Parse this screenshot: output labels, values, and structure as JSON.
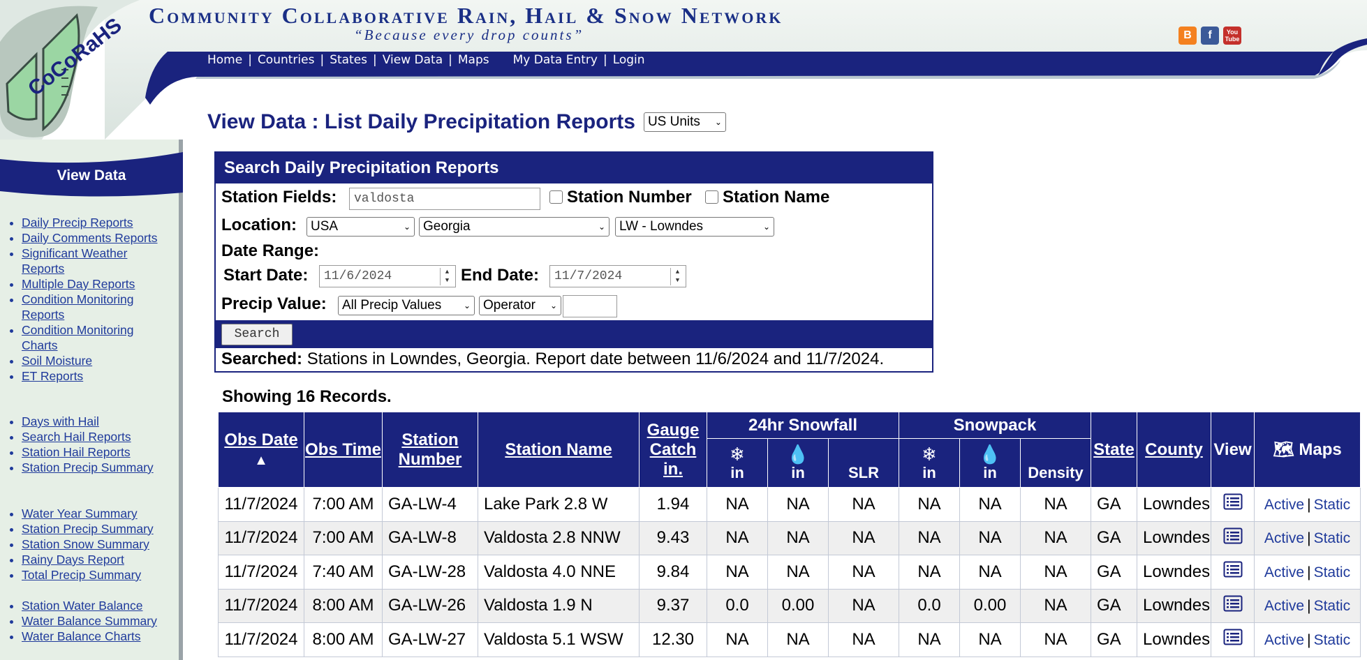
{
  "header": {
    "site_title": "Community Collaborative Rain, Hail & Snow Network",
    "logo_text": "CoCoRaHS",
    "tagline": "“Because every drop counts”",
    "nav": [
      "Home",
      "Countries",
      "States",
      "View Data",
      "Maps"
    ],
    "nav_right": [
      "My Data Entry",
      "Login"
    ],
    "social": {
      "blogger": "B",
      "facebook": "f",
      "youtube": "You Tube"
    },
    "colors": {
      "brand_blue": "#1a237e",
      "logo_green": "#9bd6a3"
    }
  },
  "sidebar": {
    "title": "View Data",
    "group1": [
      "Daily Precip Reports",
      "Daily Comments Reports",
      "Significant Weather Reports",
      "Multiple Day Reports",
      "Condition Monitoring Reports",
      "Condition Monitoring Charts",
      "Soil Moisture",
      "ET Reports"
    ],
    "group2": [
      "Days with Hail",
      "Search Hail Reports",
      "Station Hail Reports",
      "Station Precip Summary"
    ],
    "group3": [
      "Water Year Summary",
      "Station Precip Summary",
      "Station Snow Summary",
      "Rainy Days Report",
      "Total Precip Summary"
    ],
    "group4": [
      "Station Water Balance",
      "Water Balance Summary",
      "Water Balance Charts"
    ]
  },
  "main": {
    "page_title": "View Data : List Daily Precipitation Reports",
    "units_select": "US Units",
    "search": {
      "heading": "Search Daily Precipitation Reports",
      "station_fields_label": "Station Fields:",
      "station_fields_value": "valdosta",
      "station_number_label": "Station Number",
      "station_name_label": "Station Name",
      "location_label": "Location:",
      "country": "USA",
      "state": "Georgia",
      "county": "LW - Lowndes",
      "date_range_label": "Date Range:",
      "start_date_label": "Start Date:",
      "start_date": "11/6/2024",
      "end_date_label": "End Date:",
      "end_date": "11/7/2024",
      "precip_value_label": "Precip Value:",
      "precip_select": "All Precip Values",
      "operator_select": "Operator",
      "precip_input": "",
      "button_label": "Search",
      "searched_label": "Searched:",
      "searched_text": "Stations in Lowndes, Georgia. Report date between 11/6/2024 and 11/7/2024."
    },
    "record_count": "Showing 16 Records.",
    "table": {
      "headers": {
        "obs_date": "Obs Date",
        "sort_arrow": "▲",
        "obs_time": "Obs Time",
        "station_number": "Station Number",
        "station_name": "Station Name",
        "gauge_catch": "Gauge Catch in.",
        "snowfall": "24hr Snowfall",
        "snowpack": "Snowpack",
        "unit_in": "in",
        "slr": "SLR",
        "density": "Density",
        "state": "State",
        "county": "County",
        "view": "View",
        "maps": "Maps"
      },
      "links": {
        "active": "Active",
        "static": "Static",
        "pipe": "|"
      },
      "rows": [
        {
          "date": "11/7/2024",
          "time": "7:00 AM",
          "number": "GA-LW-4",
          "name": "Lake Park 2.8 W",
          "catch": "1.94",
          "sf_in": "NA",
          "sf_we": "NA",
          "slr": "NA",
          "sp_in": "NA",
          "sp_we": "NA",
          "density": "NA",
          "state": "GA",
          "county": "Lowndes"
        },
        {
          "date": "11/7/2024",
          "time": "7:00 AM",
          "number": "GA-LW-8",
          "name": "Valdosta 2.8 NNW",
          "catch": "9.43",
          "sf_in": "NA",
          "sf_we": "NA",
          "slr": "NA",
          "sp_in": "NA",
          "sp_we": "NA",
          "density": "NA",
          "state": "GA",
          "county": "Lowndes"
        },
        {
          "date": "11/7/2024",
          "time": "7:40 AM",
          "number": "GA-LW-28",
          "name": "Valdosta 4.0 NNE",
          "catch": "9.84",
          "sf_in": "NA",
          "sf_we": "NA",
          "slr": "NA",
          "sp_in": "NA",
          "sp_we": "NA",
          "density": "NA",
          "state": "GA",
          "county": "Lowndes"
        },
        {
          "date": "11/7/2024",
          "time": "8:00 AM",
          "number": "GA-LW-26",
          "name": "Valdosta 1.9 N",
          "catch": "9.37",
          "sf_in": "0.0",
          "sf_we": "0.00",
          "slr": "NA",
          "sp_in": "0.0",
          "sp_we": "0.00",
          "density": "NA",
          "state": "GA",
          "county": "Lowndes"
        },
        {
          "date": "11/7/2024",
          "time": "8:00 AM",
          "number": "GA-LW-27",
          "name": "Valdosta 5.1 WSW",
          "catch": "12.30",
          "sf_in": "NA",
          "sf_we": "NA",
          "slr": "NA",
          "sp_in": "NA",
          "sp_we": "NA",
          "density": "NA",
          "state": "GA",
          "county": "Lowndes"
        }
      ]
    }
  }
}
